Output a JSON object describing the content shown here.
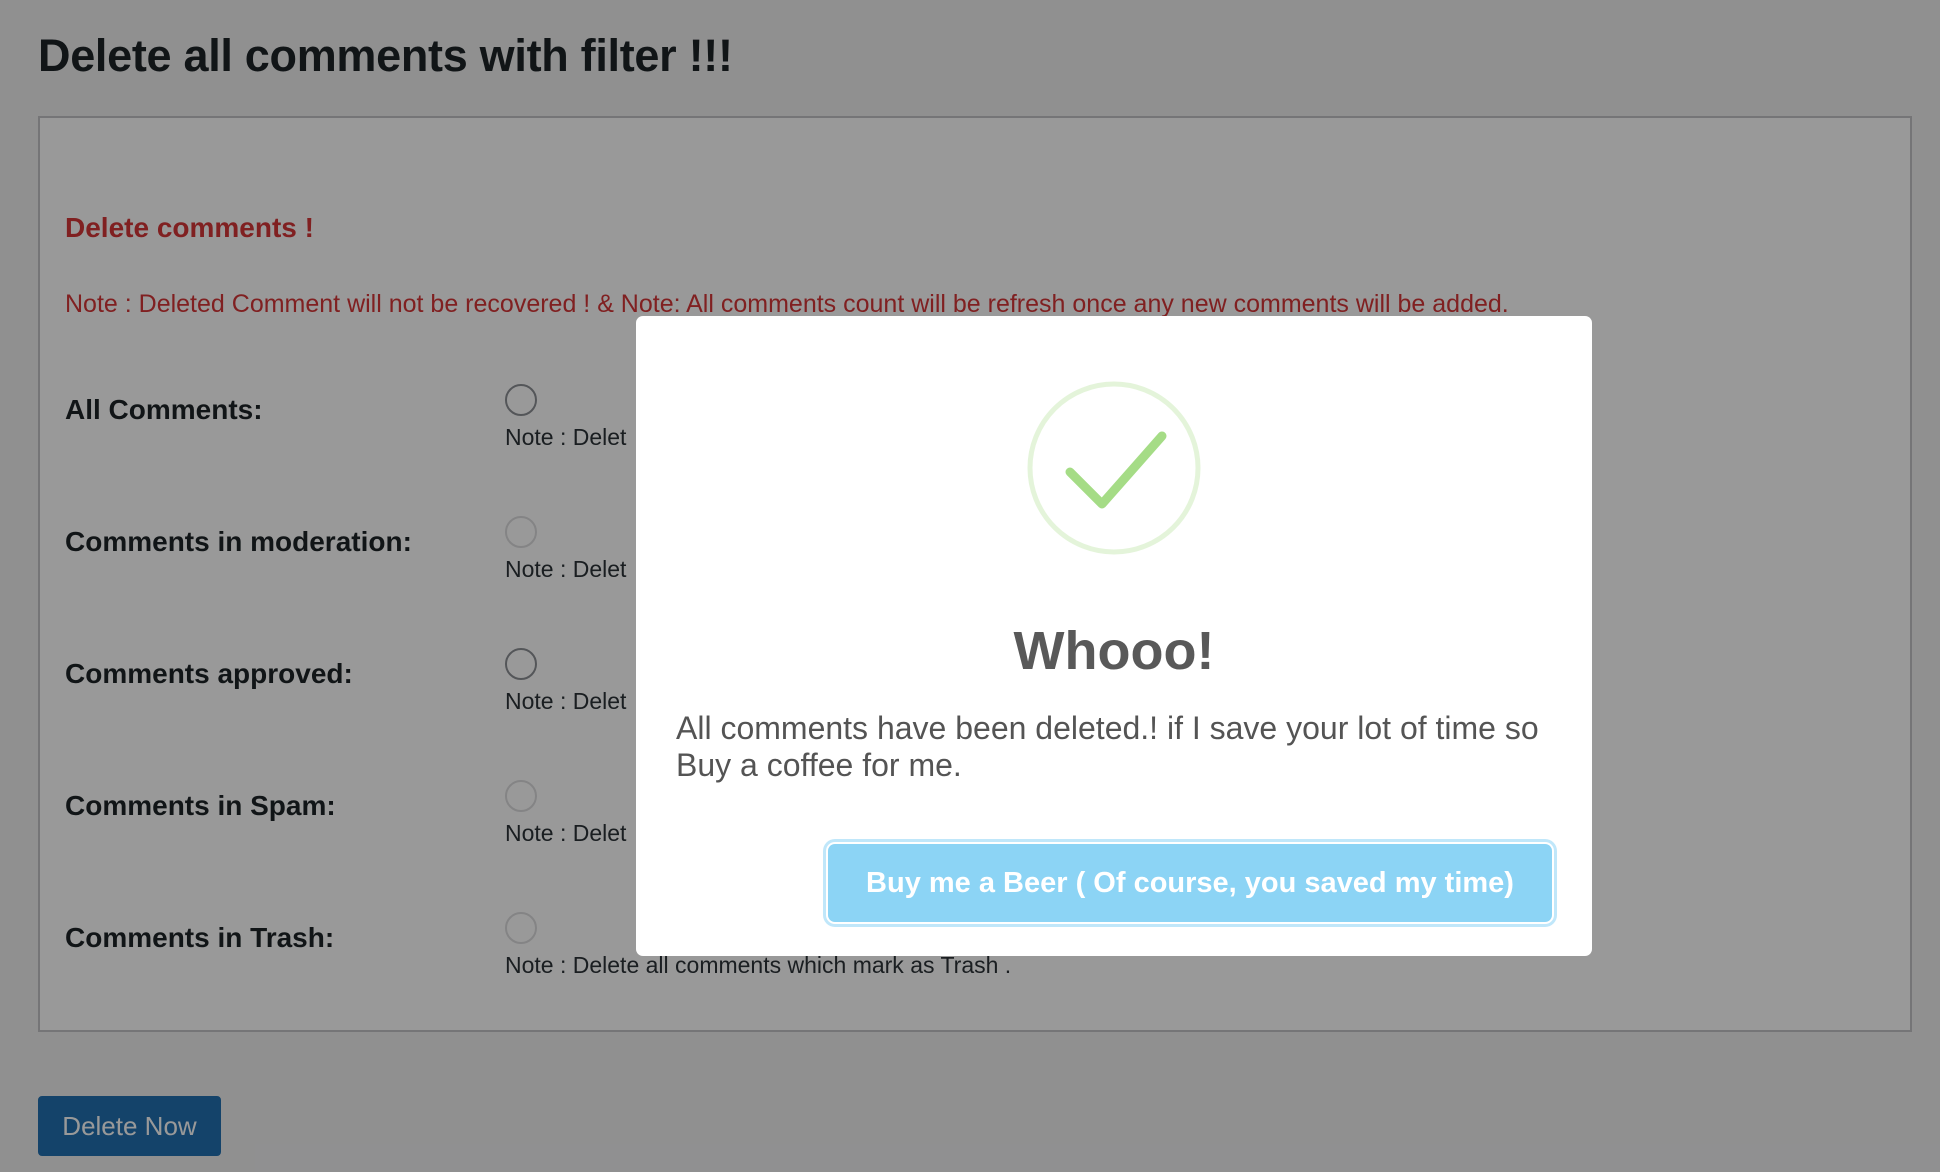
{
  "page": {
    "title": "Delete all comments with filter !!!"
  },
  "panel": {
    "heading": "Delete comments !",
    "note": "Note : Deleted Comment will not be recovered ! & Note: All comments count will be refresh once any new comments will be added.",
    "rows": [
      {
        "label": "All Comments:",
        "note": "Note : Delet",
        "radio_enabled": true
      },
      {
        "label": "Comments in moderation:",
        "note": "Note : Delet",
        "radio_enabled": false
      },
      {
        "label": "Comments approved:",
        "note": "Note : Delet",
        "radio_enabled": true
      },
      {
        "label": "Comments in Spam:",
        "note": "Note : Delet",
        "radio_enabled": false
      },
      {
        "label": "Comments in Trash:",
        "note": "Note : Delete all comments which mark as Trash .",
        "radio_enabled": false
      }
    ]
  },
  "actions": {
    "delete_label": "Delete Now"
  },
  "modal": {
    "icon": "success-check-icon",
    "title": "Whooo!",
    "text": "All comments have been deleted.! if I save your lot of time so Buy a coffee for me.",
    "button_label": "Buy me a Beer ( Of course, you saved my time)"
  },
  "colors": {
    "warning_red": "#d63638",
    "primary_button": "#2271b1",
    "modal_button": "#8cd4f5",
    "success_green": "#a5dc86"
  }
}
